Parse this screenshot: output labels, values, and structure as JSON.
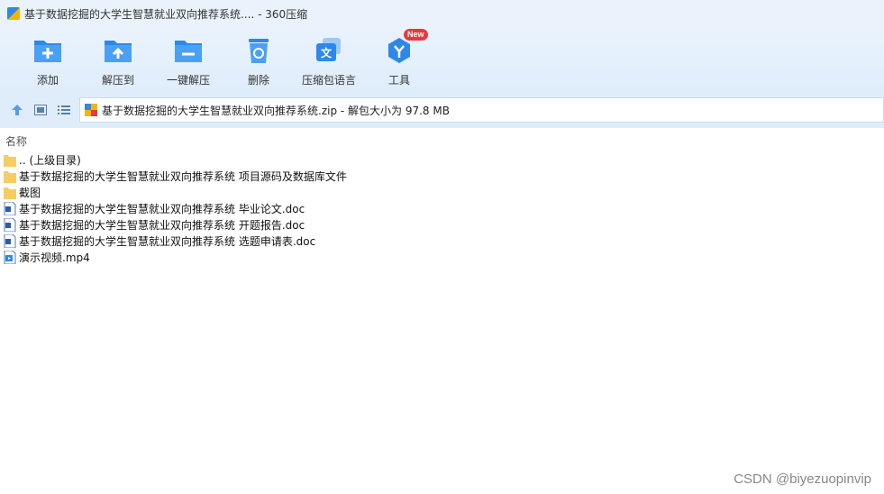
{
  "window": {
    "title": "基于数据挖掘的大学生智慧就业双向推荐系统.... - 360压缩"
  },
  "toolbar": {
    "items": [
      {
        "label": "添加",
        "icon": "add-folder-icon"
      },
      {
        "label": "解压到",
        "icon": "extract-to-icon"
      },
      {
        "label": "一键解压",
        "icon": "one-click-extract-icon"
      },
      {
        "label": "删除",
        "icon": "trash-icon"
      },
      {
        "label": "压缩包语言",
        "icon": "archive-language-icon"
      },
      {
        "label": "工具",
        "icon": "tools-icon",
        "badge": "New"
      }
    ]
  },
  "address": {
    "path": "基于数据挖掘的大学生智慧就业双向推荐系统.zip - 解包大小为 97.8 MB"
  },
  "list": {
    "column_name": "名称",
    "rows": [
      {
        "name": ".. (上级目录)",
        "type": "folder"
      },
      {
        "name": "基于数据挖掘的大学生智慧就业双向推荐系统 项目源码及数据库文件",
        "type": "folder"
      },
      {
        "name": "截图",
        "type": "folder"
      },
      {
        "name": "基于数据挖掘的大学生智慧就业双向推荐系统 毕业论文.doc",
        "type": "doc"
      },
      {
        "name": "基于数据挖掘的大学生智慧就业双向推荐系统 开题报告.doc",
        "type": "doc"
      },
      {
        "name": "基于数据挖掘的大学生智慧就业双向推荐系统 选题申请表.doc",
        "type": "doc"
      },
      {
        "name": "演示视频.mp4",
        "type": "video"
      }
    ]
  },
  "watermark": "CSDN @biyezuopinvip",
  "colors": {
    "accent": "#2f88e8",
    "toolbar_bg": "#dfedfb",
    "folder": "#f6cd5f",
    "badge": "#e8383d"
  }
}
